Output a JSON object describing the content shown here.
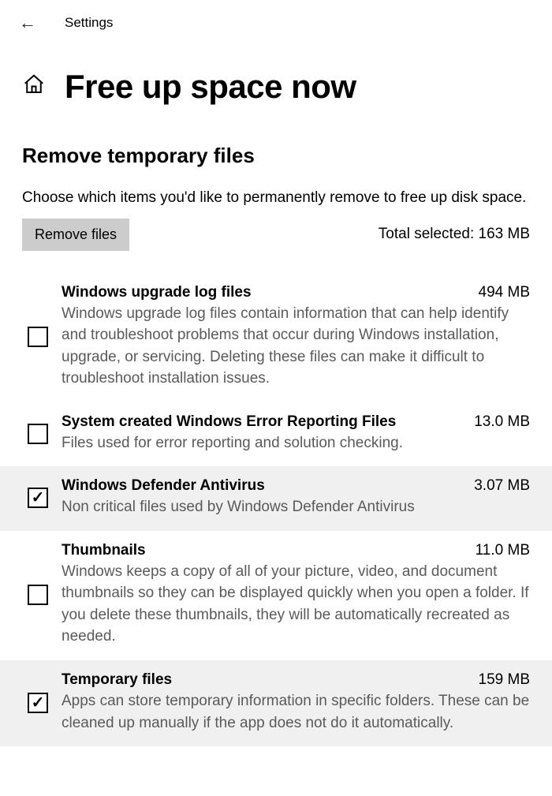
{
  "topbar": {
    "back_glyph": "←",
    "title": "Settings"
  },
  "header": {
    "home_glyph": "⌂",
    "page_title": "Free up space now"
  },
  "section": {
    "title": "Remove temporary files",
    "description": "Choose which items you'd like to permanently remove to free up disk space.",
    "remove_button": "Remove files",
    "total_selected": "Total selected: 163 MB"
  },
  "items": [
    {
      "title": "Windows upgrade log files",
      "size": "494 MB",
      "description": "Windows upgrade log files contain information that can help identify and troubleshoot problems that occur during Windows installation, upgrade, or servicing.  Deleting these files can make it difficult to troubleshoot installation issues.",
      "checked": false
    },
    {
      "title": "System created Windows Error Reporting Files",
      "size": "13.0 MB",
      "description": "Files used for error reporting and solution checking.",
      "checked": false
    },
    {
      "title": "Windows Defender Antivirus",
      "size": "3.07 MB",
      "description": "Non critical files used by Windows Defender Antivirus",
      "checked": true
    },
    {
      "title": "Thumbnails",
      "size": "11.0 MB",
      "description": "Windows keeps a copy of all of your picture, video, and document thumbnails so they can be displayed quickly when you open a folder. If you delete these thumbnails, they will be automatically recreated as needed.",
      "checked": false
    },
    {
      "title": "Temporary files",
      "size": "159 MB",
      "description": "Apps can store temporary information in specific folders. These can be cleaned up manually if the app does not do it automatically.",
      "checked": true
    }
  ]
}
